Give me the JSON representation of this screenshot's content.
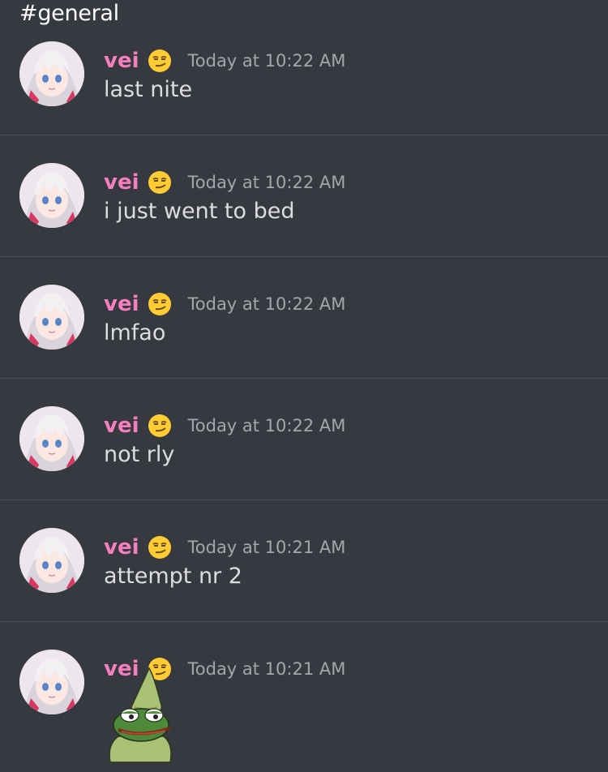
{
  "channel": {
    "title": "#general"
  },
  "messages": [
    {
      "username": "vei",
      "status_emoji": "smirking-face",
      "timestamp": "Today at 10:22 AM",
      "text": "last nite"
    },
    {
      "username": "vei",
      "status_emoji": "smirking-face",
      "timestamp": "Today at 10:22 AM",
      "text": "i just went to bed"
    },
    {
      "username": "vei",
      "status_emoji": "smirking-face",
      "timestamp": "Today at 10:22 AM",
      "text": "lmfao"
    },
    {
      "username": "vei",
      "status_emoji": "smirking-face",
      "timestamp": "Today at 10:22 AM",
      "text": "not rly"
    },
    {
      "username": "vei",
      "status_emoji": "smirking-face",
      "timestamp": "Today at 10:21 AM",
      "text": "attempt nr 2"
    },
    {
      "username": "vei",
      "status_emoji": "smirking-face",
      "timestamp": "Today at 10:21 AM",
      "attachment": "pepe-gnome-sticker"
    }
  ],
  "colors": {
    "background": "#36393f",
    "username": "#f47fbd",
    "timestamp": "#a3a6aa",
    "message_text": "#dcddde",
    "divider": "#4a4d54"
  }
}
